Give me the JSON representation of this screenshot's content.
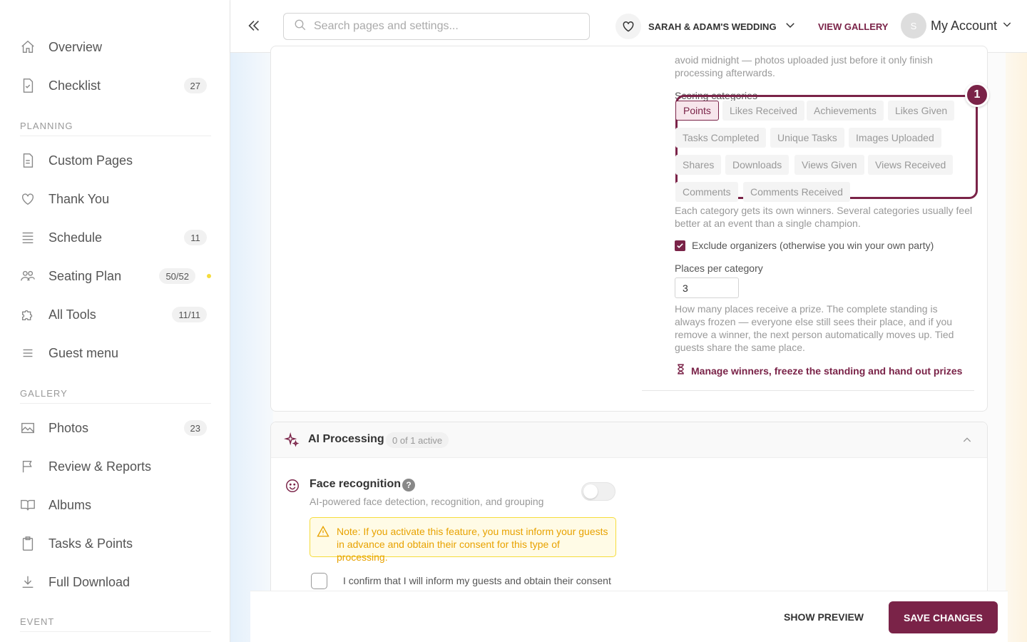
{
  "sidebar": {
    "items": [
      {
        "label": "Overview",
        "icon": "home-icon"
      },
      {
        "label": "Checklist",
        "icon": "checklist-icon",
        "badge": "27"
      }
    ],
    "sections": [
      {
        "title": "PLANNING",
        "items": [
          {
            "label": "Custom Pages",
            "icon": "page-icon"
          },
          {
            "label": "Thank You",
            "icon": "heart-icon"
          },
          {
            "label": "Schedule",
            "icon": "list-icon",
            "badge": "11"
          },
          {
            "label": "Seating Plan",
            "icon": "people-icon",
            "badge": "50/52"
          },
          {
            "label": "All Tools",
            "icon": "puzzle-icon",
            "badge": "11/11"
          },
          {
            "label": "Guest menu",
            "icon": "menu-icon"
          }
        ]
      },
      {
        "title": "GALLERY",
        "items": [
          {
            "label": "Photos",
            "icon": "image-icon",
            "badge": "23"
          },
          {
            "label": "Review & Reports",
            "icon": "flag-icon"
          },
          {
            "label": "Albums",
            "icon": "book-icon"
          },
          {
            "label": "Tasks & Points",
            "icon": "clipboard-icon"
          },
          {
            "label": "Full Download",
            "icon": "download-icon"
          }
        ]
      },
      {
        "title": "EVENT"
      }
    ]
  },
  "topbar": {
    "search_placeholder": "Search pages and settings...",
    "event_name": "SARAH & ADAM'S WEDDING",
    "view_gallery": "VIEW GALLERY",
    "avatar_initial": "S",
    "account_label": "My Account"
  },
  "leaderboard": {
    "intro_text": "avoid midnight — photos uploaded just before it only finish processing afterwards.",
    "scoring_label": "Scoring categories",
    "categories": [
      "Points",
      "Likes Received",
      "Achievements",
      "Likes Given",
      "Tasks Completed",
      "Unique Tasks",
      "Images Uploaded",
      "Shares",
      "Downloads",
      "Views Given",
      "Views Received",
      "Comments",
      "Comments Received"
    ],
    "selected_category": "Points",
    "step_number": "1",
    "category_help": "Each category gets its own winners. Several categories usually feel better at an event than a single champion.",
    "exclude_organizers_label": "Exclude organizers (otherwise you win your own party)",
    "exclude_organizers_checked": true,
    "places_label": "Places per category",
    "places_value": "3",
    "places_help": "How many places receive a prize. The complete standing is always frozen — everyone else still sees their place, and if you remove a winner, the next person automatically moves up. Tied guests share the same place.",
    "manage_link": "Manage winners, freeze the standing and hand out prizes"
  },
  "ai_processing": {
    "title": "AI Processing",
    "status": "0 of 1 active",
    "face_title": "Face recognition",
    "face_help_icon": "?",
    "face_desc": "AI-powered face detection, recognition, and grouping",
    "face_enabled": false,
    "warning": "Note: If you activate this feature, you must inform your guests in advance and obtain their consent for this type of processing.",
    "consent_label": "I confirm that I will inform my guests and obtain their consent"
  },
  "footer": {
    "preview_label": "SHOW PREVIEW",
    "save_label": "SAVE CHANGES"
  },
  "colors": {
    "accent": "#7a2348",
    "warning_bg": "#fffbe6",
    "warning_border": "#f5dc3c",
    "warning_text": "#e8a200",
    "status_dot": "#f5dc3c"
  }
}
